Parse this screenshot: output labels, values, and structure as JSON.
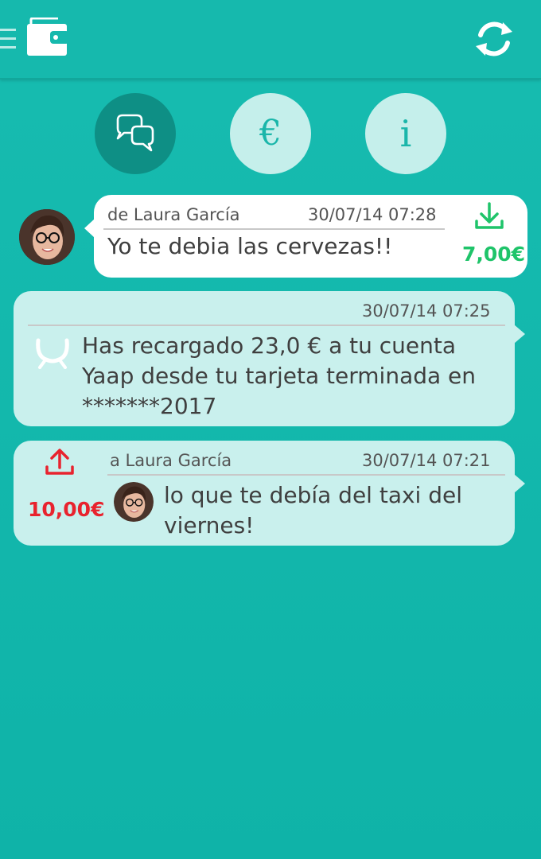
{
  "colors": {
    "background": "#12b7ab",
    "incoming_amount": "#1fc46a",
    "outgoing_amount": "#e8232e",
    "card_white": "#ffffff",
    "card_mint": "#c9f0ed",
    "active_tab": "#0e8f85",
    "inactive_tab": "#c5efeb"
  },
  "header": {
    "menu_icon": "menu-icon",
    "logo_icon": "wallet-icon",
    "refresh_icon": "refresh-icon"
  },
  "tabs": [
    {
      "name": "messages",
      "icon": "chat-bubbles-icon",
      "active": true
    },
    {
      "name": "payments",
      "label": "€",
      "active": false
    },
    {
      "name": "info",
      "label": "i",
      "active": false
    }
  ],
  "messages": [
    {
      "direction": "incoming",
      "from": "de Laura García",
      "timestamp": "30/07/14 07:28",
      "text": "Yo te debia las cervezas!!",
      "amount": "7,00€",
      "icon": "download-icon"
    },
    {
      "direction": "system",
      "timestamp": "30/07/14 07:25",
      "text": "Has recargado 23,0 € a tu cuenta Yaap desde tu tarjeta terminada en *******2017",
      "icon": "yaap-logo-icon"
    },
    {
      "direction": "outgoing",
      "to": "a Laura García",
      "timestamp": "30/07/14 07:21",
      "text": "lo que te debía del taxi del viernes!",
      "amount": "10,00€",
      "icon": "upload-icon"
    }
  ]
}
